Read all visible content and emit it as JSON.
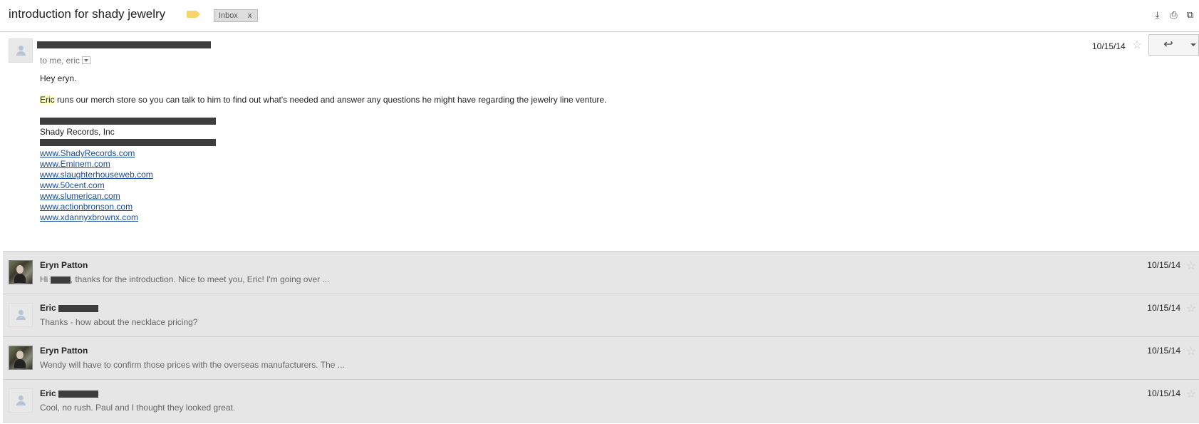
{
  "thread": {
    "subject": "introduction for shady jewelry",
    "label": "Inbox",
    "label_close": "x",
    "header_icons": [
      "download-icon",
      "print-icon",
      "new-window-icon"
    ]
  },
  "open_message": {
    "to_line": "to me, eric",
    "date": "10/15/14",
    "star": "☆",
    "reply_glyph": "↩",
    "greeting": "Hey eryn.",
    "highlight_word": "Eric",
    "body_rest": " runs our merch store so you can talk to him to find out what's needed and answer any questions he might have regarding the jewelry line venture.",
    "signature_company": "Shady Records, Inc",
    "links": [
      "www.ShadyRecords.com",
      "www.Eminem.com",
      "www.slaughterhouseweb.com",
      "www.50cent.com",
      "www.slumerican.com",
      "www.actionbronson.com",
      "www.xdannyxbrownx.com"
    ]
  },
  "collapsed_messages": [
    {
      "name": "Eryn Patton",
      "snippet_pre": "Hi ",
      "snippet_post": ", thanks for the introduction. Nice to meet you, Eric! I'm going over ...",
      "date": "10/15/14",
      "avatar": "photo"
    },
    {
      "name": "Eric",
      "snippet": "Thanks - how about the necklace pricing?",
      "date": "10/15/14",
      "avatar": "default"
    },
    {
      "name": "Eryn Patton",
      "snippet": "Wendy will have to confirm those prices with the overseas manufacturers. The ...",
      "date": "10/15/14",
      "avatar": "photo"
    },
    {
      "name": "Eric",
      "snippet": "Cool, no rush. Paul and I thought they looked great.",
      "date": "10/15/14",
      "avatar": "default"
    }
  ]
}
